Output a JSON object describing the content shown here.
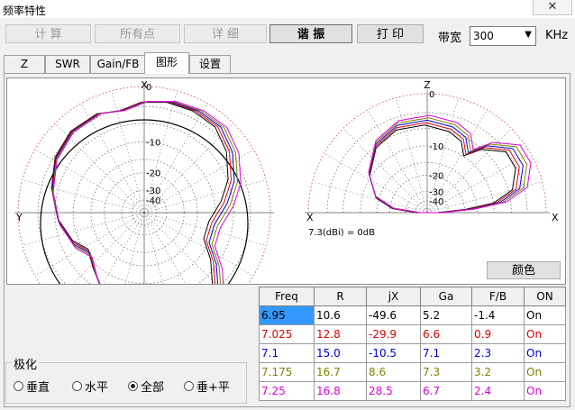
{
  "window": {
    "title": "频率特性",
    "close_glyph": "✕"
  },
  "toolbar": {
    "calc": "计 算",
    "all_points": "所有点",
    "detail": "详 细",
    "resonate": "谐 振",
    "print": "打 印",
    "bandwidth_label": "带宽",
    "bandwidth_value": "300",
    "bandwidth_unit": "KHz"
  },
  "tabs": [
    "Z",
    "SWR",
    "Gain/FB",
    "图形",
    "设置"
  ],
  "active_tab": "图形",
  "plots": {
    "horizontal": {
      "top_label": "X",
      "left_label": "Y",
      "ring_labels": [
        "0",
        "-10",
        "-20",
        "-30",
        "-40"
      ]
    },
    "vertical": {
      "top_label": "Z",
      "left_label": "X",
      "ring_labels": [
        "0",
        "-10",
        "-20",
        "-30",
        "-40"
      ],
      "ref_note": "7.3(dBi) = 0dB"
    }
  },
  "color_button": "颜色",
  "polarization": {
    "title": "极化",
    "options": [
      "垂直",
      "水平",
      "全部",
      "垂+平"
    ],
    "selected": "全部"
  },
  "table": {
    "headers": [
      "Freq",
      "R",
      "jX",
      "Ga",
      "F/B",
      "ON"
    ],
    "rows": [
      {
        "cells": [
          "6.95",
          "10.6",
          "-49.6",
          "5.2",
          "-1.4",
          "On"
        ],
        "color": "#000000"
      },
      {
        "cells": [
          "7.025",
          "12.8",
          "-29.9",
          "6.6",
          "0.9",
          "On"
        ],
        "color": "#e00000"
      },
      {
        "cells": [
          "7.1",
          "15.0",
          "-10.5",
          "7.1",
          "2.3",
          "On"
        ],
        "color": "#0000e0"
      },
      {
        "cells": [
          "7.175",
          "16.7",
          "8.6",
          "7.3",
          "3.2",
          "On"
        ],
        "color": "#808000"
      },
      {
        "cells": [
          "7.25",
          "16.8",
          "28.5",
          "6.7",
          "2.4",
          "On"
        ],
        "color": "#e000e0"
      }
    ],
    "selected_cell": "6.95"
  },
  "colors": {
    "selected_bg": "#3399ff",
    "trace_colors": [
      "#000000",
      "#e00000",
      "#0000e0",
      "#808000",
      "#e000e0"
    ]
  }
}
